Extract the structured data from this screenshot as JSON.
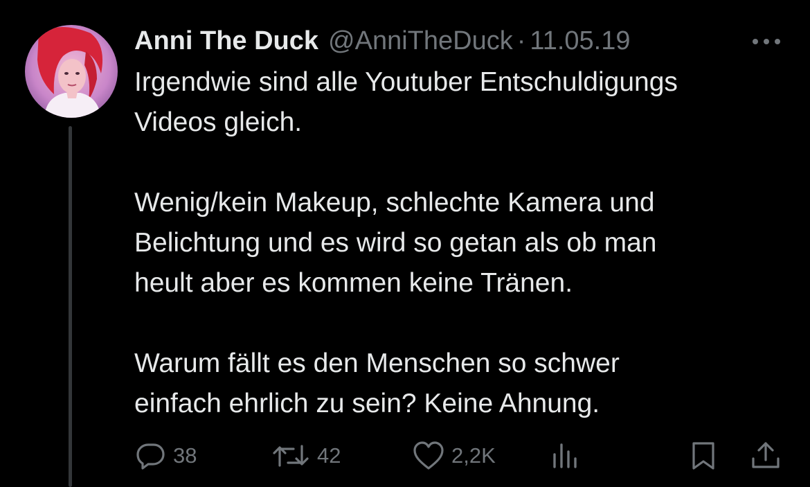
{
  "tweet": {
    "author": {
      "display_name": "Anni The Duck",
      "handle": "@AnniTheDuck",
      "avatar_icon": "profile-photo"
    },
    "separator": "·",
    "timestamp": "11.05.19",
    "more_icon": "more-horizontal-icon",
    "text": {
      "p1_line1": "Irgendwie sind alle Youtuber Entschuldigungs",
      "p1_line2": "Videos gleich.",
      "p2_line1": "Wenig/kein Makeup, schlechte Kamera und",
      "p2_line2": "Belichtung und es wird so getan als ob man",
      "p2_line3": "heult aber es kommen keine Tränen.",
      "p3_line1": "Warum fällt es den Menschen so schwer",
      "p3_line2": "einfach ehrlich zu sein? Keine Ahnung."
    },
    "actions": {
      "reply": {
        "icon": "reply-icon",
        "count": "38"
      },
      "retweet": {
        "icon": "retweet-icon",
        "count": "42"
      },
      "like": {
        "icon": "heart-icon",
        "count": "2,2K"
      },
      "views": {
        "icon": "views-icon"
      },
      "bookmark": {
        "icon": "bookmark-icon"
      },
      "share": {
        "icon": "share-icon"
      }
    }
  },
  "colors": {
    "background": "#000000",
    "primary_text": "#e7e9ea",
    "secondary_text": "#71767b",
    "thread_line": "#333639"
  }
}
